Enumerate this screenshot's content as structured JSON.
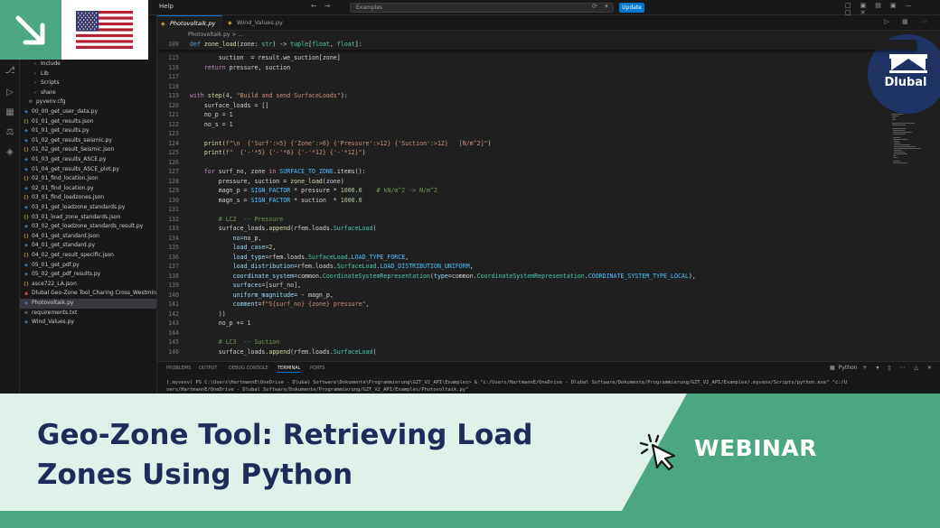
{
  "window": {
    "menu": [
      "Help"
    ],
    "search_placeholder": "Examples",
    "update_label": "Update"
  },
  "explorer": {
    "items": [
      {
        "label": "Include",
        "icon": "folder-icon",
        "indent": 2
      },
      {
        "label": "Lib",
        "icon": "folder-icon",
        "indent": 2
      },
      {
        "label": "Scripts",
        "icon": "folder-icon",
        "indent": 2
      },
      {
        "label": "share",
        "icon": "folder-icon",
        "indent": 2
      },
      {
        "label": "pyvenv.cfg",
        "icon": "gear-icon",
        "indent": 1
      },
      {
        "label": "00_00_get_user_data.py",
        "icon": "python-icon",
        "indent": 0
      },
      {
        "label": "01_01_get_results.json",
        "icon": "json-icon",
        "indent": 0
      },
      {
        "label": "01_01_get_results.py",
        "icon": "python-icon",
        "indent": 0
      },
      {
        "label": "01_02_get_results_seismic.py",
        "icon": "python-icon",
        "indent": 0
      },
      {
        "label": "01_02_get_result_Seismic.json",
        "icon": "json-icon",
        "indent": 0
      },
      {
        "label": "01_03_get_results_ASCE.py",
        "icon": "python-icon",
        "indent": 0
      },
      {
        "label": "01_04_get_results_ASCE_plot.py",
        "icon": "python-icon",
        "indent": 0
      },
      {
        "label": "02_01_find_location.json",
        "icon": "json-icon",
        "indent": 0
      },
      {
        "label": "02_01_find_location.py",
        "icon": "python-icon",
        "indent": 0
      },
      {
        "label": "03_01_find_loadzones.json",
        "icon": "json-icon",
        "indent": 0
      },
      {
        "label": "03_01_get_loadzone_standards.py",
        "icon": "python-icon",
        "indent": 0
      },
      {
        "label": "03_01_load_zone_standards.json",
        "icon": "json-icon",
        "indent": 0
      },
      {
        "label": "03_02_get_loadzone_standards_result.py",
        "icon": "python-icon",
        "indent": 0
      },
      {
        "label": "04_01_get_standard.json",
        "icon": "json-icon",
        "indent": 0
      },
      {
        "label": "04_01_get_standard.py",
        "icon": "python-icon",
        "indent": 0
      },
      {
        "label": "04_02_get_result_specific.json",
        "icon": "json-icon",
        "indent": 0
      },
      {
        "label": "05_01_get_pdf.py",
        "icon": "python-icon",
        "indent": 0
      },
      {
        "label": "05_02_get_pdf_results.py",
        "icon": "python-icon",
        "indent": 0
      },
      {
        "label": "asce722_LA.json",
        "icon": "json-icon",
        "indent": 0
      },
      {
        "label": "Dlubal Geo-Zone Tool_Charing Cross_Westmin...",
        "icon": "pdf-icon",
        "indent": 0
      },
      {
        "label": "Photovoltaik.py",
        "icon": "python-icon",
        "indent": 0,
        "selected": true
      },
      {
        "label": "requirements.txt",
        "icon": "text-icon",
        "indent": 0
      },
      {
        "label": "Wind_Values.py",
        "icon": "python-icon",
        "indent": 0
      }
    ]
  },
  "tabs": [
    {
      "label": "Photovoltaik.py",
      "active": true
    },
    {
      "label": "Wind_Values.py",
      "active": false
    }
  ],
  "breadcrumb": "Photovoltaik.py > ...",
  "code": {
    "sticky": {
      "ln": "108",
      "text": "def zone_load(zone: str) -> tuple[float, float]:"
    },
    "lines": [
      {
        "ln": "115",
        "text": "        suction  = result.we_suction[zone]"
      },
      {
        "ln": "116",
        "text": "    return pressure, suction"
      },
      {
        "ln": "117",
        "text": ""
      },
      {
        "ln": "118",
        "text": ""
      },
      {
        "ln": "119",
        "text": "with step(4, \"Build and send SurfaceLoads\"):"
      },
      {
        "ln": "120",
        "text": "    surface_loads = []"
      },
      {
        "ln": "121",
        "text": "    no_p = 1"
      },
      {
        "ln": "122",
        "text": "    no_s = 1"
      },
      {
        "ln": "123",
        "text": ""
      },
      {
        "ln": "124",
        "text": "    print(f\"\\n  {'Surf':>5} {'Zone':>6} {'Pressure':>12} {'Suction':>12}   [N/m^2]\")"
      },
      {
        "ln": "125",
        "text": "    print(f\"  {'-'*5} {'-'*6} {'-'*12} {'-'*12}\")"
      },
      {
        "ln": "126",
        "text": ""
      },
      {
        "ln": "127",
        "text": "    for surf_no, zone in SURFACE_TO_ZONE.items():"
      },
      {
        "ln": "128",
        "text": "        pressure, suction = zone_load(zone)"
      },
      {
        "ln": "129",
        "text": "        magn_p = SIGN_FACTOR * pressure * 1000.0    # kN/m^2 -> N/m^2"
      },
      {
        "ln": "130",
        "text": "        magn_s = SIGN_FACTOR * suction  * 1000.0"
      },
      {
        "ln": "131",
        "text": ""
      },
      {
        "ln": "132",
        "text": "        # LC2  -- Pressure"
      },
      {
        "ln": "133",
        "text": "        surface_loads.append(rfem.loads.SurfaceLoad("
      },
      {
        "ln": "134",
        "text": "            no=no_p,"
      },
      {
        "ln": "135",
        "text": "            load_case=2,"
      },
      {
        "ln": "136",
        "text": "            load_type=rfem.loads.SurfaceLoad.LOAD_TYPE_FORCE,"
      },
      {
        "ln": "137",
        "text": "            load_distribution=rfem.loads.SurfaceLoad.LOAD_DISTRIBUTION_UNIFORM,"
      },
      {
        "ln": "138",
        "text": "            coordinate_system=common.CoordinateSystemRepresentation(type=common.CoordinateSystemRepresentation.COORDINATE_SYSTEM_TYPE_LOCAL),"
      },
      {
        "ln": "139",
        "text": "            surfaces=[surf_no],"
      },
      {
        "ln": "140",
        "text": "            uniform_magnitude= - magn_p,"
      },
      {
        "ln": "141",
        "text": "            comment=f\"S{surf_no} {zone} pressure\","
      },
      {
        "ln": "142",
        "text": "        ))"
      },
      {
        "ln": "143",
        "text": "        no_p += 1"
      },
      {
        "ln": "144",
        "text": ""
      },
      {
        "ln": "145",
        "text": "        # LC3  -- Suction"
      },
      {
        "ln": "146",
        "text": "        surface_loads.append(rfem.loads.SurfaceLoad("
      }
    ]
  },
  "panel": {
    "tabs": [
      "PROBLEMS",
      "OUTPUT",
      "DEBUG CONSOLE",
      "TERMINAL",
      "PORTS"
    ],
    "active_tab": "TERMINAL",
    "shell_label": "Python",
    "terminal_lines": [
      "(.myvenv) PS C:\\Users\\HartmannE\\OneDrive - Dlubal Software\\Dokumente\\Programmierung\\GZT_V2_API\\Examples> & \"c:/Users/HartmannE/OneDrive - Dlubal Software/Dokumente/Programmierung/GZT_V2_API/Examples/.myvenv/Scripts/python.exe\" \"c:/U",
      "sers/HartmannE/OneDrive - Dlubal Software/Dokumente/Programmierung/GZT_V2_API/Examples/Photovoltaik.py\""
    ]
  },
  "brand": {
    "logo_text": "Dlubal",
    "flag": "us-flag-icon",
    "corner_icon": "arrow-down-right-icon",
    "green": "#4aa782",
    "navy": "#1e2c5a",
    "light_green": "#e0f1ea"
  },
  "banner": {
    "title": "Geo-Zone Tool: Retrieving Load Zones Using Python",
    "tag": "WEBINAR",
    "tag_icon": "click-cursor-icon"
  }
}
